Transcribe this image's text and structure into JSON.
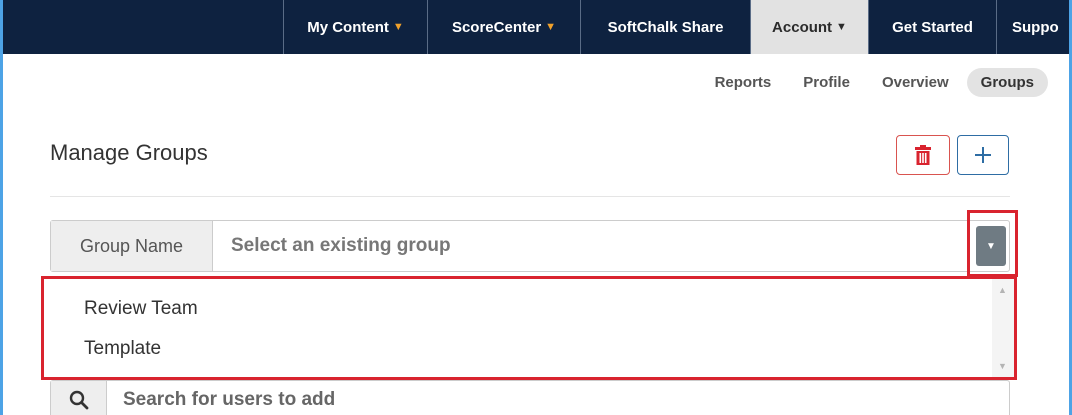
{
  "topnav": {
    "tabs": [
      {
        "label": "My Content",
        "caret": "▼"
      },
      {
        "label": "ScoreCenter",
        "caret": "▼"
      },
      {
        "label": "SoftChalk Share"
      },
      {
        "label": "Account",
        "caret": "▼"
      },
      {
        "label": "Get Started"
      },
      {
        "label": "Suppo"
      }
    ]
  },
  "subnav": {
    "items": [
      "Reports",
      "Profile",
      "Overview",
      "Groups"
    ]
  },
  "page": {
    "title": "Manage Groups"
  },
  "group": {
    "label": "Group Name",
    "placeholder": "Select an existing group",
    "options": [
      "Review Team",
      "Template"
    ]
  },
  "search": {
    "placeholder": "Search for users to add"
  },
  "colors": {
    "nav_bg": "#0e2240",
    "caret_orange": "#f0a12b",
    "delete_red": "#d9534f",
    "add_blue": "#2e6da4",
    "highlight_red": "#d9232e"
  }
}
